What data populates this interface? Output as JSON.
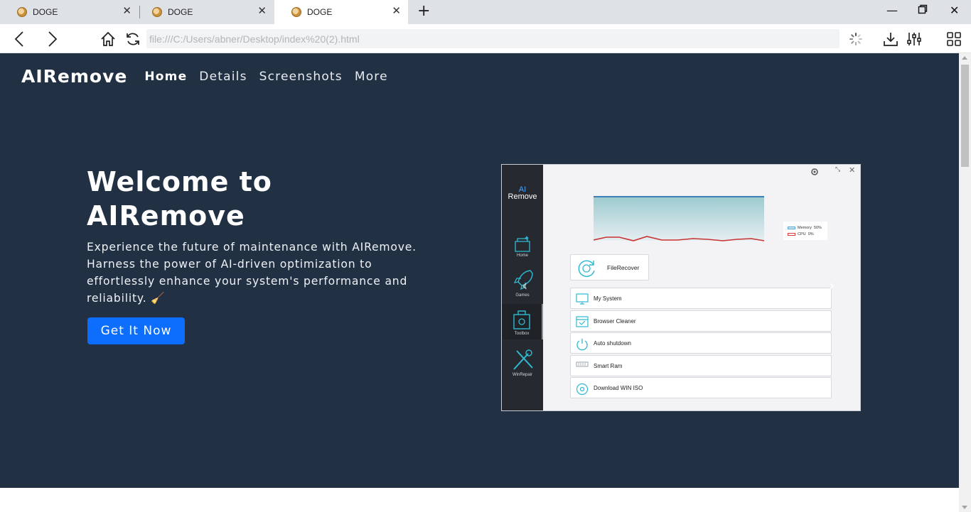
{
  "browser": {
    "tabs": [
      {
        "title": "DOGE"
      },
      {
        "title": "DOGE"
      },
      {
        "title": "DOGE"
      }
    ],
    "address": "file:///C:/Users/abner/Desktop/index%20(2).html"
  },
  "site": {
    "brand": "AIRemove",
    "nav": [
      "Home",
      "Details",
      "Screenshots",
      "More"
    ],
    "hero": {
      "title": "Welcome to AIRemove",
      "lead": "Experience the future of maintenance with AIRemove. Harness the power of AI-driven optimization to effortlessly enhance your system's performance and reliability.",
      "lead_emoji": "🧹",
      "cta": "Get It Now"
    }
  },
  "app_screenshot": {
    "logo_top": "AI",
    "logo_bottom": "Remove",
    "side_items": [
      "Home",
      "Games",
      "Toolbox",
      "WinRepair"
    ],
    "legend": [
      {
        "label": "Memory",
        "value": "50%",
        "color": "#58a6d6"
      },
      {
        "label": "CPU",
        "value": "0%",
        "color": "#d93a3a"
      }
    ],
    "file_recover": "FileRecover",
    "rows": [
      "My System",
      "Browser Cleaner",
      "Auto shutdown",
      "Smart Ram",
      "Download WIN ISO"
    ]
  },
  "colors": {
    "hero_bg": "#213043",
    "cta": "#0d6efd",
    "accent_icon": "#2fb9d2"
  }
}
